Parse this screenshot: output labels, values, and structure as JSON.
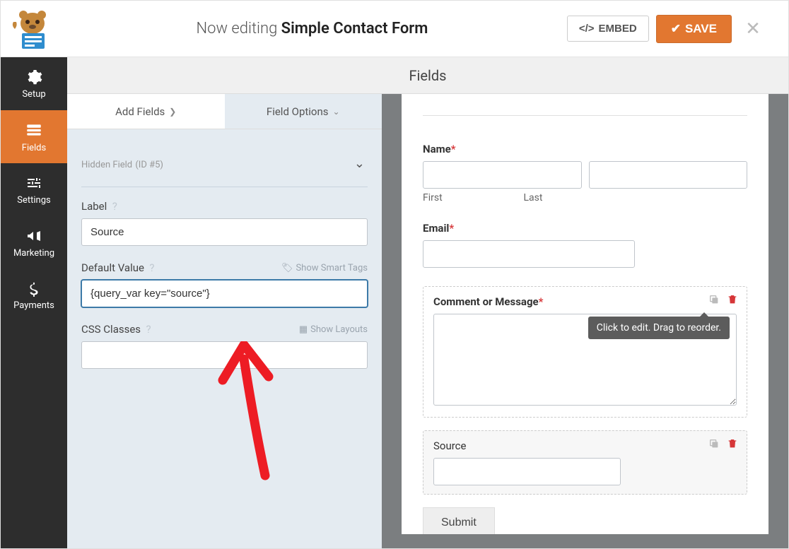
{
  "header": {
    "editing_prefix": "Now editing ",
    "form_name": "Simple Contact Form",
    "embed_label": "EMBED",
    "save_label": "SAVE"
  },
  "sidebar": {
    "items": [
      {
        "label": "Setup"
      },
      {
        "label": "Fields"
      },
      {
        "label": "Settings"
      },
      {
        "label": "Marketing"
      },
      {
        "label": "Payments"
      }
    ]
  },
  "panel_title": "Fields",
  "tabs": {
    "add": "Add Fields",
    "options": "Field Options"
  },
  "options": {
    "heading": "Hidden Field",
    "id_label": "(ID #5)",
    "label_label": "Label",
    "label_value": "Source",
    "default_label": "Default Value",
    "smart_tags": "Show Smart Tags",
    "default_value": "{query_var key=\"source\"}",
    "css_label": "CSS Classes",
    "show_layouts": "Show Layouts",
    "css_value": ""
  },
  "preview": {
    "name_label": "Name",
    "first_sub": "First",
    "last_sub": "Last",
    "email_label": "Email",
    "comment_label": "Comment or Message",
    "tooltip": "Click to edit. Drag to reorder.",
    "source_label": "Source",
    "submit_label": "Submit"
  }
}
